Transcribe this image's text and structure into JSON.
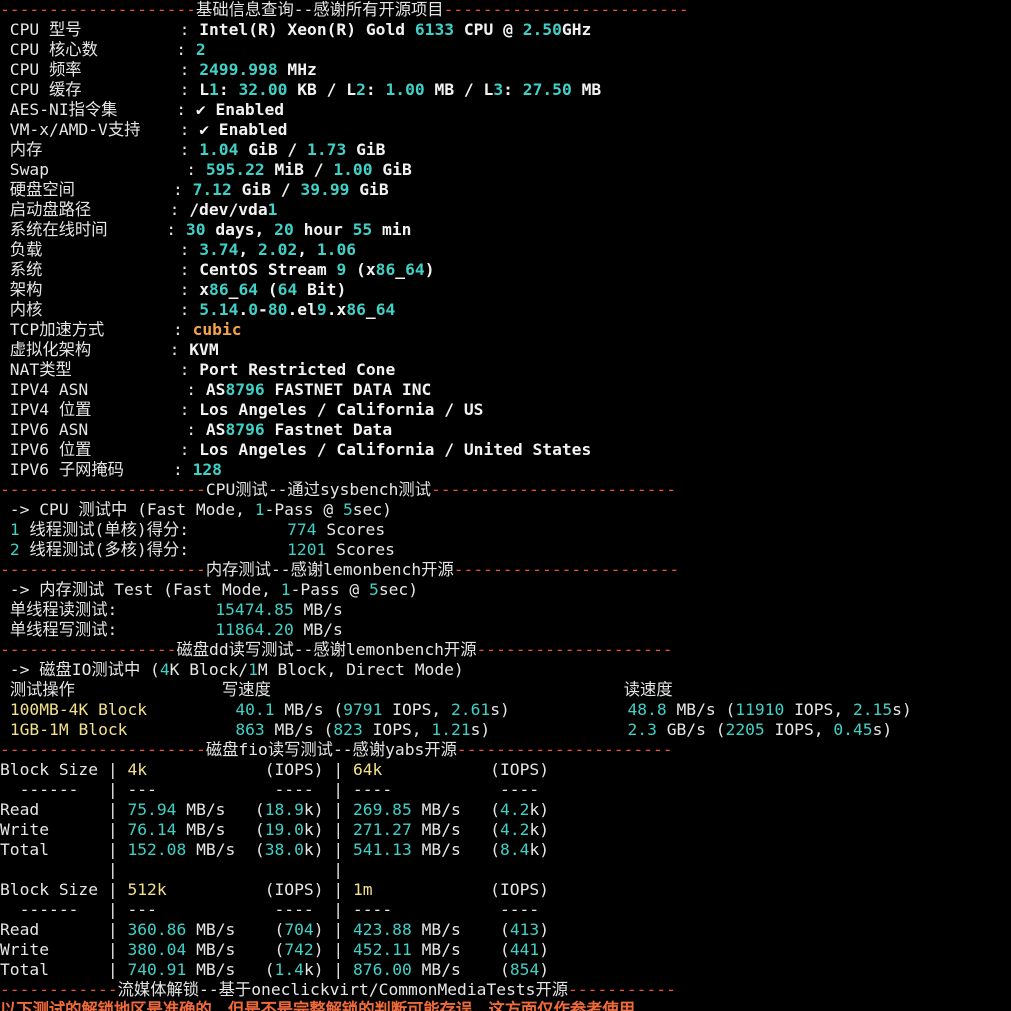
{
  "sections": {
    "basic": "基础信息查询--感谢所有开源项目",
    "cpu": "CPU测试--通过sysbench测试",
    "mem": "内存测试--感谢lemonbench开源",
    "dd": "磁盘dd读写测试--感谢lemonbench开源",
    "fio": "磁盘fio读写测试--感谢yabs开源",
    "media": "流媒体解锁--基于oneclickvirt/CommonMediaTests开源"
  },
  "basic_info": [
    {
      "label": "CPU 型号",
      "value": "Intel(R) Xeon(R) Gold 6133 CPU @ 2.50GHz"
    },
    {
      "label": "CPU 核心数",
      "value": "2"
    },
    {
      "label": "CPU 频率",
      "value": "2499.998 MHz"
    },
    {
      "label": "CPU 缓存",
      "value": "L1: 32.00 KB / L2: 1.00 MB / L3: 27.50 MB"
    },
    {
      "label": "AES-NI指令集",
      "value": "✔ Enabled"
    },
    {
      "label": "VM-x/AMD-V支持",
      "value": "✔ Enabled"
    },
    {
      "label": "内存",
      "value": "1.04 GiB / 1.73 GiB"
    },
    {
      "label": "Swap",
      "value": "595.22 MiB / 1.00 GiB"
    },
    {
      "label": "硬盘空间",
      "value": "7.12 GiB / 39.99 GiB"
    },
    {
      "label": "启动盘路径",
      "value": "/dev/vda1"
    },
    {
      "label": "系统在线时间",
      "value": "30 days, 20 hour 55 min"
    },
    {
      "label": "负载",
      "value": "3.74, 2.02, 1.06"
    },
    {
      "label": "系统",
      "value": "CentOS Stream 9 (x86_64)"
    },
    {
      "label": "架构",
      "value": "x86_64 (64 Bit)"
    },
    {
      "label": "内核",
      "value": "5.14.0-80.el9.x86_64"
    },
    {
      "label": "TCP加速方式",
      "value": "cubic"
    },
    {
      "label": "虚拟化架构",
      "value": "KVM"
    },
    {
      "label": "NAT类型",
      "value": "Port Restricted Cone"
    },
    {
      "label": "IPV4 ASN",
      "value": "AS8796 FASTNET DATA INC"
    },
    {
      "label": "IPV4 位置",
      "value": "Los Angeles / California / US"
    },
    {
      "label": "IPV6 ASN",
      "value": "AS8796 Fastnet Data"
    },
    {
      "label": "IPV6 位置",
      "value": "Los Angeles / California / United States"
    },
    {
      "label": "IPV6 子网掩码",
      "value": "128"
    }
  ],
  "cpu_test": {
    "header": "-> CPU 测试中 (Fast Mode, 1-Pass @ 5sec)",
    "rows": [
      {
        "label": "1 线程测试(单核)得分:",
        "score": "774",
        "unit": "Scores"
      },
      {
        "label": "2 线程测试(多核)得分:",
        "score": "1201",
        "unit": "Scores"
      }
    ]
  },
  "mem_test": {
    "header": "-> 内存测试 Test (Fast Mode, 1-Pass @ 5sec)",
    "rows": [
      {
        "label": "单线程读测试:",
        "value": "15474.85",
        "unit": "MB/s"
      },
      {
        "label": "单线程写测试:",
        "value": "11864.20",
        "unit": "MB/s"
      }
    ]
  },
  "dd_test": {
    "header": "-> 磁盘IO测试中 (4K Block/1M Block, Direct Mode)",
    "col_op": "测试操作",
    "col_write": "写速度",
    "col_read": "读速度",
    "rows": [
      {
        "op": "100MB-4K Block",
        "write": "40.1 MB/s (9791 IOPS, 2.61s)",
        "read": "48.8 MB/s (11910 IOPS, 2.15s)"
      },
      {
        "op": "1GB-1M Block",
        "write": "863 MB/s (823 IOPS, 1.21s)",
        "read": "2.3 GB/s (2205 IOPS, 0.45s)"
      }
    ]
  },
  "fio_lines": [
    "Block Size | 4k            (IOPS) | 64k           (IOPS)",
    "  ------   | ---            ----  | ----           ---- ",
    "Read       | 75.94 MB/s   (18.9k) | 269.85 MB/s   (4.2k)",
    "Write      | 76.14 MB/s   (19.0k) | 271.27 MB/s   (4.2k)",
    "Total      | 152.08 MB/s  (38.0k) | 541.13 MB/s   (8.4k)",
    "           |                      |                     ",
    "Block Size | 512k          (IOPS) | 1m            (IOPS)",
    "  ------   | ---            ----  | ----           ---- ",
    "Read       | 360.86 MB/s    (704) | 423.88 MB/s    (413)",
    "Write      | 380.04 MB/s    (742) | 452.11 MB/s    (441)",
    "Total      | 740.91 MB/s   (1.4k) | 876.00 MB/s    (854)"
  ],
  "media_note": "以下测试的解锁地区是准确的，但是不是完整解锁的判断可能存误，这方面仅作参考使用"
}
